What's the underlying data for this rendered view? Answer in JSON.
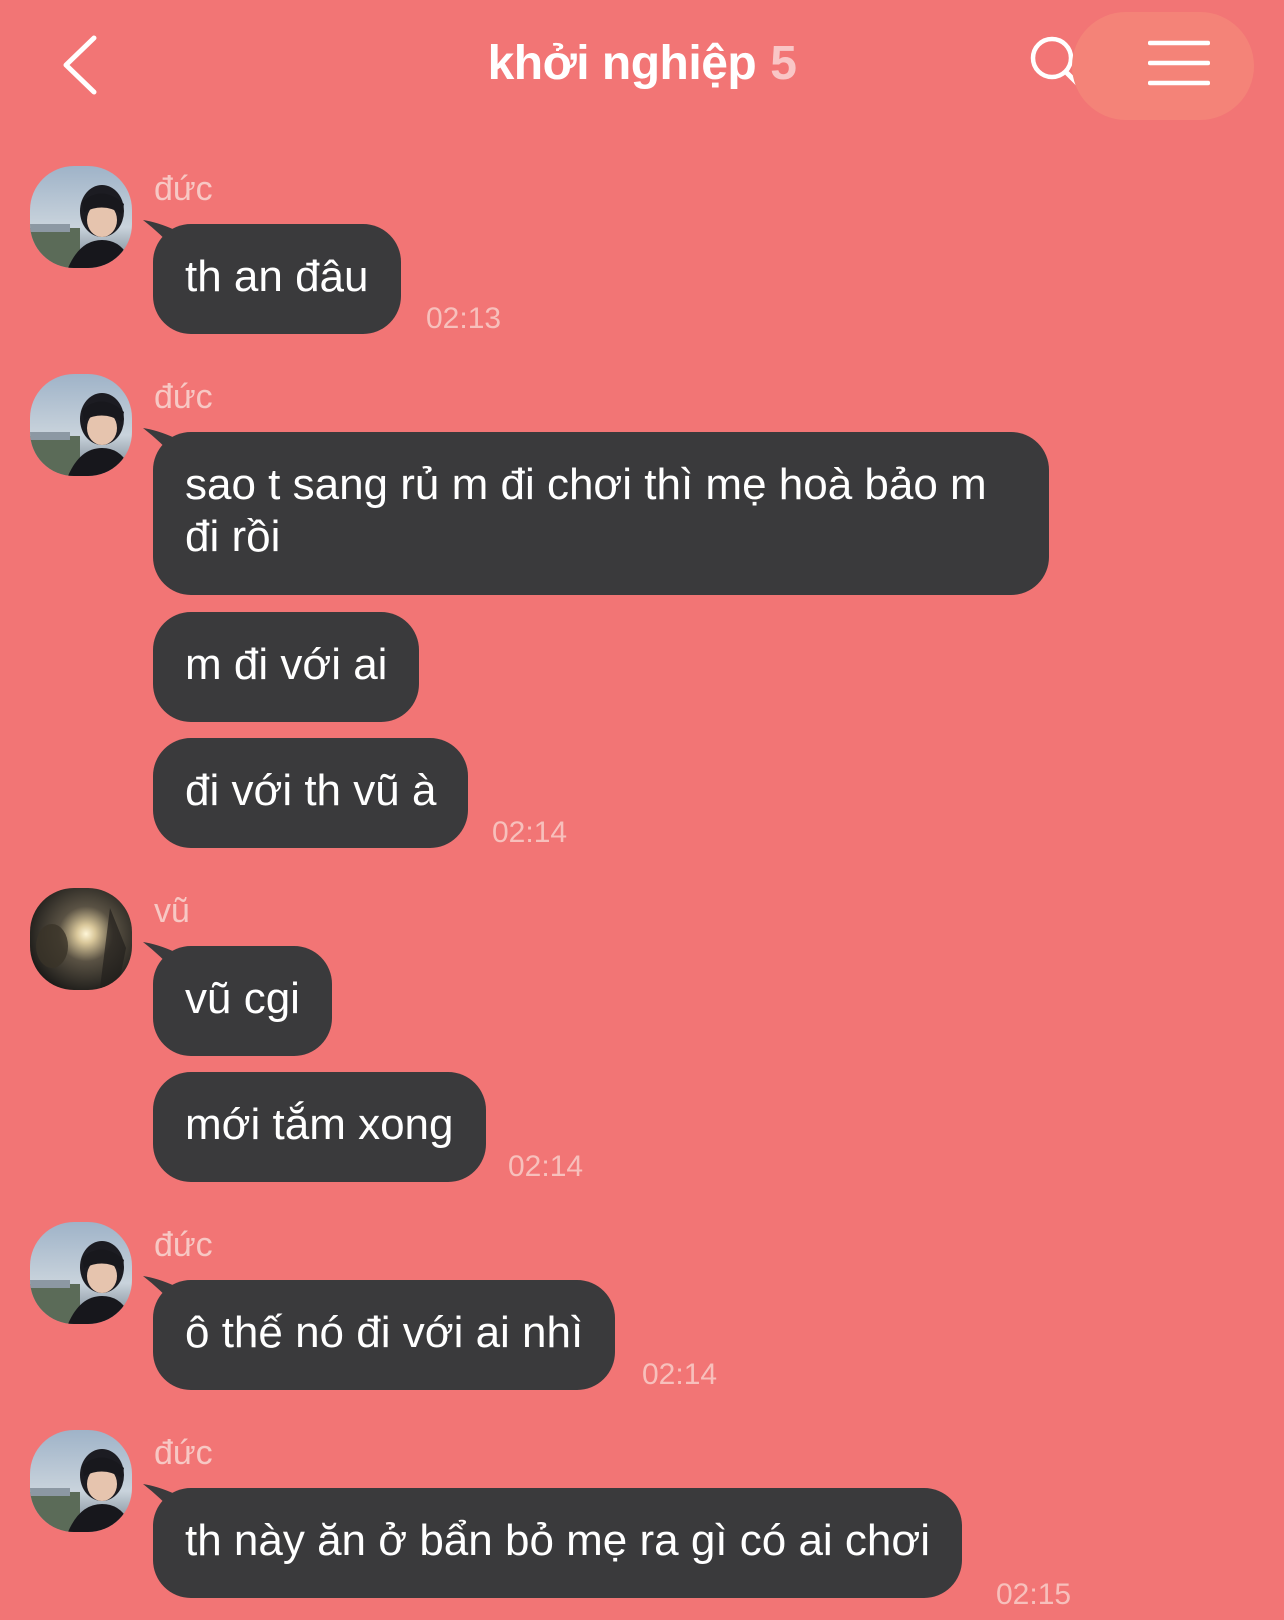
{
  "header": {
    "title": "khởi nghiệp",
    "member_count": "5",
    "back_icon": "chevron-left-icon",
    "search_icon": "search-icon",
    "menu_icon": "hamburger-menu-icon"
  },
  "colors": {
    "background": "#f27575",
    "bubble": "#3a3a3c",
    "text": "#ffffff",
    "meta": "#f7c0bc"
  },
  "messages": [
    {
      "sender": "đức",
      "bubbles": [
        "th an đâu"
      ],
      "time": "02:13"
    },
    {
      "sender": "đức",
      "bubbles": [
        "sao t sang rủ m đi chơi thì mẹ hoà bảo m đi rồi",
        "m đi với ai",
        "đi với th vũ à"
      ],
      "time": "02:14"
    },
    {
      "sender": "vũ",
      "bubbles": [
        "vũ cgi",
        "mới tắm xong"
      ],
      "time": "02:14"
    },
    {
      "sender": "đức",
      "bubbles": [
        "ô thế nó đi với ai nhì"
      ],
      "time": "02:14"
    },
    {
      "sender": "đức",
      "bubbles": [
        "th này ăn ở bẩn bỏ mẹ ra gì có ai chơi"
      ],
      "time": "02:15"
    }
  ]
}
